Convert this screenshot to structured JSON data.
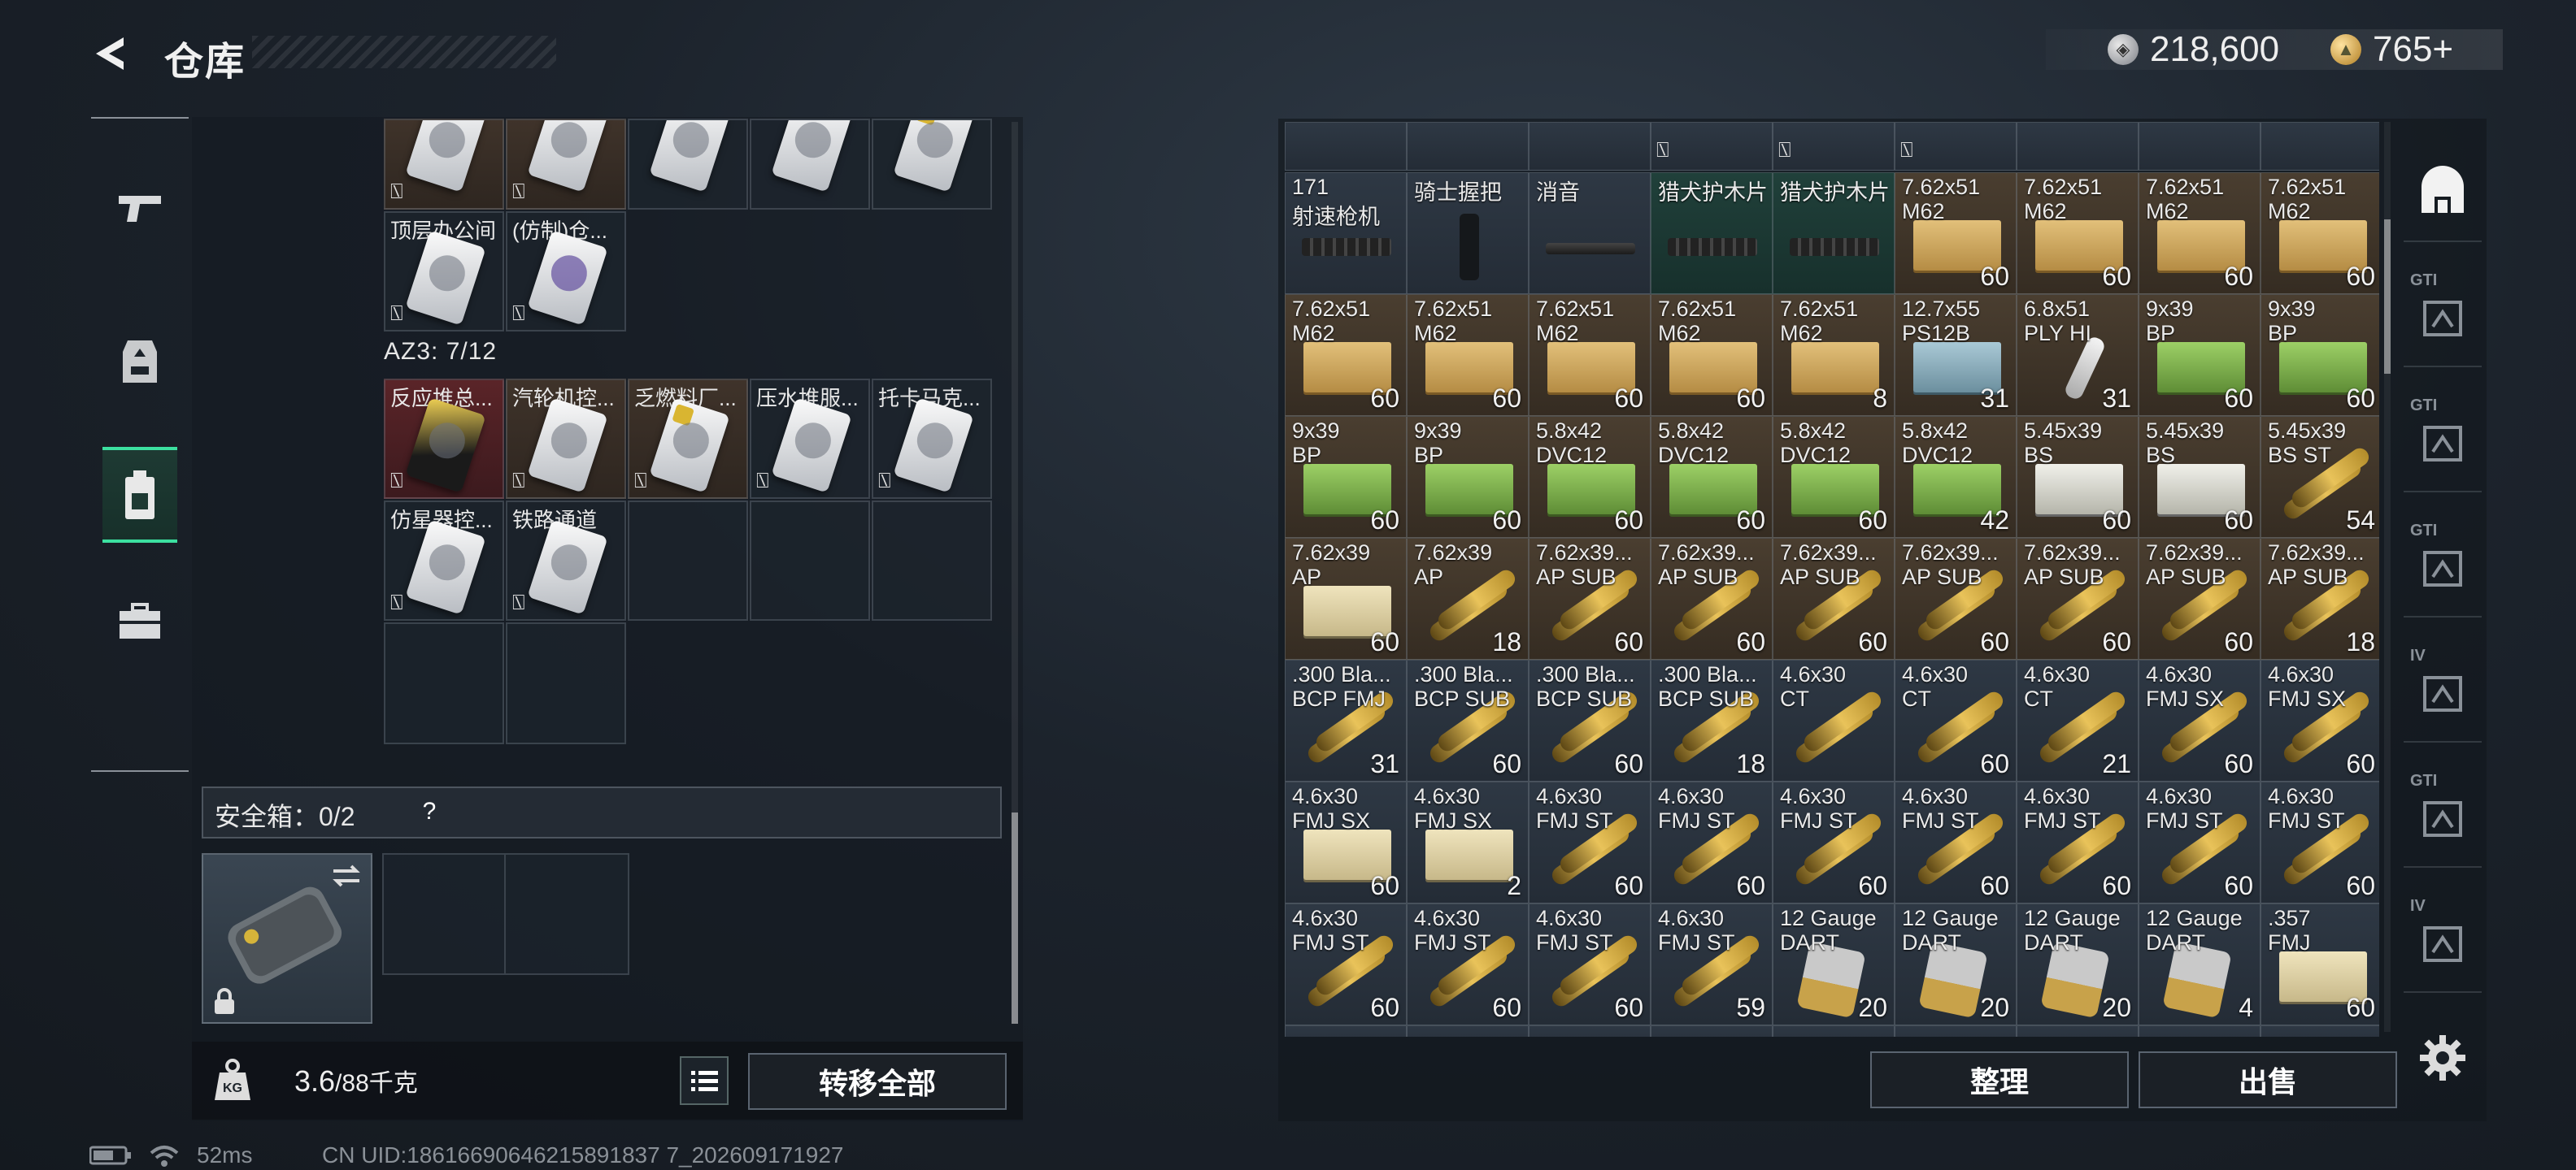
{
  "header": {
    "title": "仓库"
  },
  "currency": {
    "silver": "218,600",
    "gold": "765+"
  },
  "nav": {
    "items": [
      "weapons",
      "gear",
      "backpack",
      "toolbox"
    ],
    "active": 2
  },
  "left": {
    "top_row_partial": [
      "",
      "",
      "",
      "",
      ""
    ],
    "row2": [
      {
        "name": "顶层办公间",
        "style": "gray"
      },
      {
        "name": "(仿制)仓...",
        "style": "gray"
      }
    ],
    "az3_label": "AZ3: 7/12",
    "az3_items": [
      {
        "name": "反应堆总...",
        "style": "red",
        "card": "blacky"
      },
      {
        "name": "汽轮机控...",
        "style": "brown",
        "card": "white"
      },
      {
        "name": "乏燃料厂...",
        "style": "brown",
        "card": "yellow"
      },
      {
        "name": "压水堆服...",
        "style": "gray",
        "card": "white"
      },
      {
        "name": "托卡马克...",
        "style": "gray",
        "card": "white"
      },
      {
        "name": "仿星器控...",
        "style": "gray",
        "card": "white"
      },
      {
        "name": "铁路通道",
        "style": "gray",
        "card": "white"
      }
    ],
    "safe_box_label": "安全箱：0/2",
    "safe_help": "?",
    "weight_value": "3.6",
    "weight_rest": "/88千克",
    "transfer_all": "转移全部",
    "no_icon_glyph": "⍂"
  },
  "right": {
    "top_partial_row": [
      {
        "style": "gray"
      },
      {
        "style": "gray"
      },
      {
        "style": "gray"
      },
      {
        "style": "gray"
      },
      {
        "style": "gray"
      },
      {
        "style": "gray"
      },
      {
        "style": "gray"
      },
      {
        "style": "gray"
      },
      {
        "style": "gray"
      }
    ],
    "rows": [
      [
        {
          "t1": "171",
          "t2": "射速枪机",
          "q": "",
          "style": "gray",
          "icon": "rail"
        },
        {
          "t1": "骑士握把",
          "t2": "",
          "q": "",
          "style": "gray",
          "icon": "grip"
        },
        {
          "t1": "消音",
          "t2": "",
          "q": "",
          "style": "gray",
          "icon": "tube"
        },
        {
          "t1": "猎犬护木片",
          "t2": "",
          "q": "",
          "style": "green",
          "icon": "rail"
        },
        {
          "t1": "猎犬护木片",
          "t2": "",
          "q": "",
          "style": "green",
          "icon": "rail"
        },
        {
          "t1": "7.62x51",
          "t2": "M62",
          "q": "60",
          "style": "brown",
          "icon": "cardboard"
        },
        {
          "t1": "7.62x51",
          "t2": "M62",
          "q": "60",
          "style": "brown",
          "icon": "cardboard"
        },
        {
          "t1": "7.62x51",
          "t2": "M62",
          "q": "60",
          "style": "brown",
          "icon": "cardboard"
        },
        {
          "t1": "7.62x51",
          "t2": "M62",
          "q": "60",
          "style": "brown",
          "icon": "cardboard"
        }
      ],
      [
        {
          "t1": "7.62x51",
          "t2": "M62",
          "q": "60",
          "style": "brown",
          "icon": "cardboard"
        },
        {
          "t1": "7.62x51",
          "t2": "M62",
          "q": "60",
          "style": "brown",
          "icon": "cardboard"
        },
        {
          "t1": "7.62x51",
          "t2": "M62",
          "q": "60",
          "style": "brown",
          "icon": "cardboard"
        },
        {
          "t1": "7.62x51",
          "t2": "M62",
          "q": "60",
          "style": "brown",
          "icon": "cardboard"
        },
        {
          "t1": "7.62x51",
          "t2": "M62",
          "q": "8",
          "style": "brown",
          "icon": "cardboard"
        },
        {
          "t1": "12.7x55",
          "t2": "PS12B",
          "q": "31",
          "style": "brown",
          "icon": "bluebox"
        },
        {
          "t1": "6.8x51",
          "t2": "PLY HI",
          "q": "31",
          "style": "brown",
          "icon": "slug"
        },
        {
          "t1": "9x39",
          "t2": "BP",
          "q": "60",
          "style": "brown",
          "icon": "greenbox"
        },
        {
          "t1": "9x39",
          "t2": "BP",
          "q": "60",
          "style": "brown",
          "icon": "greenbox"
        }
      ],
      [
        {
          "t1": "9x39",
          "t2": "BP",
          "q": "60",
          "style": "brown",
          "icon": "greenbox"
        },
        {
          "t1": "9x39",
          "t2": "BP",
          "q": "60",
          "style": "brown",
          "icon": "greenbox"
        },
        {
          "t1": "5.8x42",
          "t2": "DVC12",
          "q": "60",
          "style": "brown",
          "icon": "greenbox"
        },
        {
          "t1": "5.8x42",
          "t2": "DVC12",
          "q": "60",
          "style": "brown",
          "icon": "greenbox"
        },
        {
          "t1": "5.8x42",
          "t2": "DVC12",
          "q": "60",
          "style": "brown",
          "icon": "greenbox"
        },
        {
          "t1": "5.8x42",
          "t2": "DVC12",
          "q": "42",
          "style": "brown",
          "icon": "greenbox"
        },
        {
          "t1": "5.45x39",
          "t2": "BS",
          "q": "60",
          "style": "brown",
          "icon": "whitebox"
        },
        {
          "t1": "5.45x39",
          "t2": "BS",
          "q": "60",
          "style": "brown",
          "icon": "whitebox"
        },
        {
          "t1": "5.45x39",
          "t2": "BS ST",
          "q": "54",
          "style": "brown",
          "icon": "bullet"
        }
      ],
      [
        {
          "t1": "7.62x39",
          "t2": "AP",
          "q": "60",
          "style": "brown",
          "icon": "cream"
        },
        {
          "t1": "7.62x39",
          "t2": "AP",
          "q": "18",
          "style": "brown",
          "icon": "bullet"
        },
        {
          "t1": "7.62x39...",
          "t2": "AP SUB",
          "q": "60",
          "style": "brown",
          "icon": "bullet"
        },
        {
          "t1": "7.62x39...",
          "t2": "AP SUB",
          "q": "60",
          "style": "brown",
          "icon": "bullet"
        },
        {
          "t1": "7.62x39...",
          "t2": "AP SUB",
          "q": "60",
          "style": "brown",
          "icon": "bullet"
        },
        {
          "t1": "7.62x39...",
          "t2": "AP SUB",
          "q": "60",
          "style": "brown",
          "icon": "bullet"
        },
        {
          "t1": "7.62x39...",
          "t2": "AP SUB",
          "q": "60",
          "style": "brown",
          "icon": "bullet"
        },
        {
          "t1": "7.62x39...",
          "t2": "AP SUB",
          "q": "60",
          "style": "brown",
          "icon": "bullet"
        },
        {
          "t1": "7.62x39...",
          "t2": "AP SUB",
          "q": "18",
          "style": "brown",
          "icon": "bullet"
        }
      ],
      [
        {
          "t1": ".300 Bla...",
          "t2": "BCP FMJ",
          "q": "31",
          "style": "gray",
          "icon": "bullet"
        },
        {
          "t1": ".300 Bla...",
          "t2": "BCP SUB",
          "q": "60",
          "style": "gray",
          "icon": "bullet"
        },
        {
          "t1": ".300 Bla...",
          "t2": "BCP SUB",
          "q": "60",
          "style": "gray",
          "icon": "bullet"
        },
        {
          "t1": ".300 Bla...",
          "t2": "BCP SUB",
          "q": "18",
          "style": "gray",
          "icon": "bullet"
        },
        {
          "t1": "4.6x30",
          "t2": "CT",
          "q": "",
          "style": "gray",
          "icon": "bullet"
        },
        {
          "t1": "4.6x30",
          "t2": "CT",
          "q": "60",
          "style": "gray",
          "icon": "bullet"
        },
        {
          "t1": "4.6x30",
          "t2": "CT",
          "q": "21",
          "style": "gray",
          "icon": "bullet"
        },
        {
          "t1": "4.6x30",
          "t2": "FMJ SX",
          "q": "60",
          "style": "gray",
          "icon": "bullet"
        },
        {
          "t1": "4.6x30",
          "t2": "FMJ SX",
          "q": "60",
          "style": "gray",
          "icon": "bullet"
        }
      ],
      [
        {
          "t1": "4.6x30",
          "t2": "FMJ SX",
          "q": "60",
          "style": "gray",
          "icon": "cream"
        },
        {
          "t1": "4.6x30",
          "t2": "FMJ SX",
          "q": "2",
          "style": "gray",
          "icon": "cream"
        },
        {
          "t1": "4.6x30",
          "t2": "FMJ ST",
          "q": "60",
          "style": "gray",
          "icon": "bullet"
        },
        {
          "t1": "4.6x30",
          "t2": "FMJ ST",
          "q": "60",
          "style": "gray",
          "icon": "bullet"
        },
        {
          "t1": "4.6x30",
          "t2": "FMJ ST",
          "q": "60",
          "style": "gray",
          "icon": "bullet"
        },
        {
          "t1": "4.6x30",
          "t2": "FMJ ST",
          "q": "60",
          "style": "gray",
          "icon": "bullet"
        },
        {
          "t1": "4.6x30",
          "t2": "FMJ ST",
          "q": "60",
          "style": "gray",
          "icon": "bullet"
        },
        {
          "t1": "4.6x30",
          "t2": "FMJ ST",
          "q": "60",
          "style": "gray",
          "icon": "bullet"
        },
        {
          "t1": "4.6x30",
          "t2": "FMJ ST",
          "q": "60",
          "style": "gray",
          "icon": "bullet"
        }
      ],
      [
        {
          "t1": "4.6x30",
          "t2": "FMJ ST",
          "q": "60",
          "style": "gray",
          "icon": "bullet"
        },
        {
          "t1": "4.6x30",
          "t2": "FMJ ST",
          "q": "60",
          "style": "gray",
          "icon": "bullet"
        },
        {
          "t1": "4.6x30",
          "t2": "FMJ ST",
          "q": "60",
          "style": "gray",
          "icon": "bullet"
        },
        {
          "t1": "4.6x30",
          "t2": "FMJ ST",
          "q": "59",
          "style": "gray",
          "icon": "bullet"
        },
        {
          "t1": "12 Gauge",
          "t2": "DART",
          "q": "20",
          "style": "gray",
          "icon": "shell"
        },
        {
          "t1": "12 Gauge",
          "t2": "DART",
          "q": "20",
          "style": "gray",
          "icon": "shell"
        },
        {
          "t1": "12 Gauge",
          "t2": "DART",
          "q": "20",
          "style": "gray",
          "icon": "shell"
        },
        {
          "t1": "12 Gauge",
          "t2": "DART",
          "q": "4",
          "style": "gray",
          "icon": "shell"
        },
        {
          "t1": ".357",
          "t2": "FMJ",
          "q": "60",
          "style": "gray",
          "icon": "cream"
        }
      ]
    ],
    "sort_label": "整理",
    "sell_label": "出售",
    "filters": [
      "all",
      "gt1-a",
      "gt1-b",
      "gt1-c",
      "iv-add",
      "gt1-d",
      "iv-b"
    ],
    "filter_labels": [
      "",
      "GTI",
      "GTI",
      "GTI",
      "IV",
      "GTI",
      "IV"
    ]
  },
  "status": {
    "ping": "52ms",
    "uid": "CN UID:18616690646215891837 7_202609171927"
  },
  "colors": {
    "accent": "#3ce0a0",
    "panel": "#141a20"
  }
}
